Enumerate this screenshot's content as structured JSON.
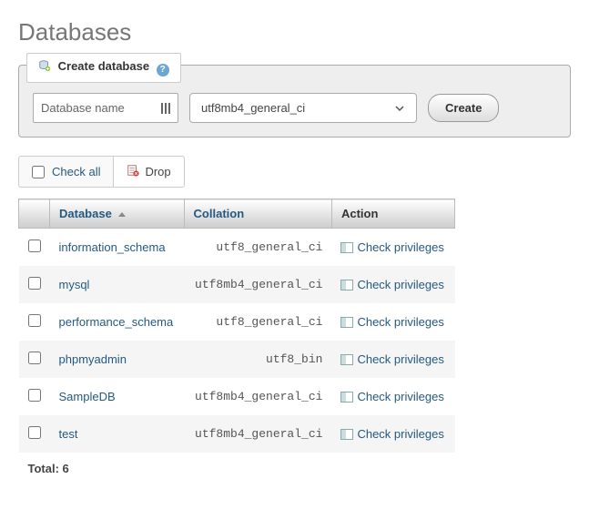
{
  "page_title": "Databases",
  "create_form": {
    "legend": "Create database",
    "name_placeholder": "Database name",
    "collation_selected": "utf8mb4_general_ci",
    "submit_label": "Create"
  },
  "toolbar": {
    "check_all_label": "Check all",
    "drop_label": "Drop"
  },
  "table": {
    "headers": {
      "database": "Database",
      "collation": "Collation",
      "action": "Action"
    },
    "rows": [
      {
        "name": "information_schema",
        "collation": "utf8_general_ci",
        "action": "Check privileges"
      },
      {
        "name": "mysql",
        "collation": "utf8mb4_general_ci",
        "action": "Check privileges"
      },
      {
        "name": "performance_schema",
        "collation": "utf8_general_ci",
        "action": "Check privileges"
      },
      {
        "name": "phpmyadmin",
        "collation": "utf8_bin",
        "action": "Check privileges"
      },
      {
        "name": "SampleDB",
        "collation": "utf8mb4_general_ci",
        "action": "Check privileges"
      },
      {
        "name": "test",
        "collation": "utf8mb4_general_ci",
        "action": "Check privileges"
      }
    ],
    "total_label": "Total: 6"
  }
}
